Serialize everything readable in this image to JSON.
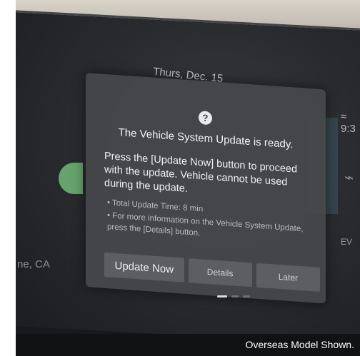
{
  "header": {
    "date": "Thurs, Dec. 15",
    "clock": "9:3"
  },
  "background": {
    "left_city": "ne, CA",
    "right_label": "EV"
  },
  "dialog": {
    "icon": "question-circle-icon",
    "title": "The Vehicle System Update is ready.",
    "message": "Press the [Update Now] button to proceed with the update. Vehicle cannot be used during the update.",
    "note_total_time": "• Total Update Time: 8 min",
    "note_more_info": "• For more information on the Vehicle System Update, press the [Details] button.",
    "buttons": {
      "update_now": "Update Now",
      "details": "Details",
      "later": "Later"
    }
  },
  "footer": {
    "disclaimer": "Overseas Model Shown."
  },
  "colors": {
    "dialog_bg": "#46474a",
    "button_bg": "#5c5e62",
    "text": "#eef0f2"
  }
}
